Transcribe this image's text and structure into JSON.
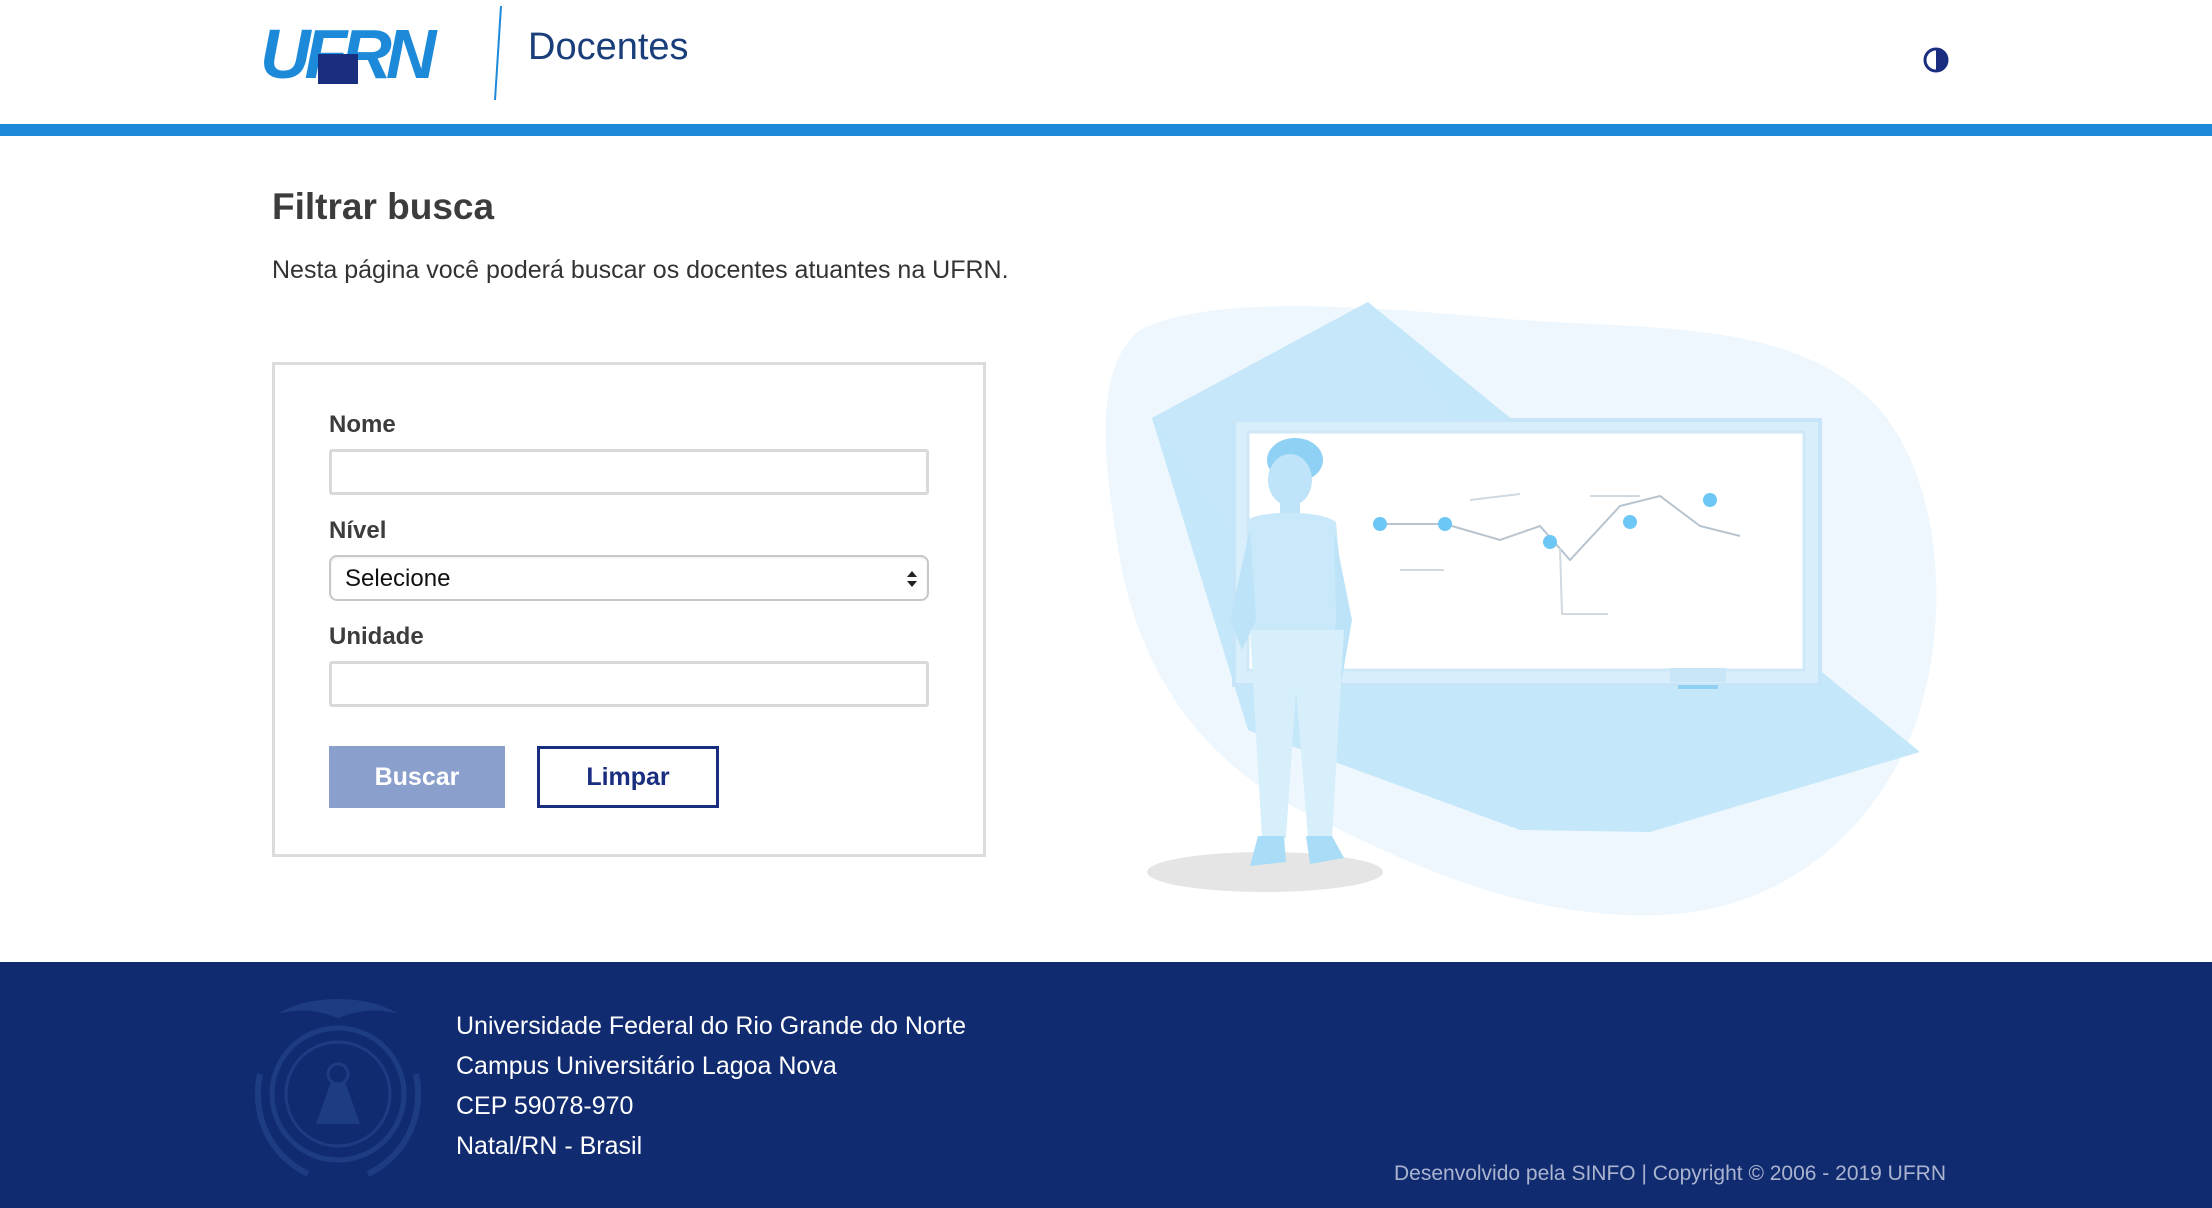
{
  "header": {
    "logo_text": "UFRN",
    "app_title": "Docentes",
    "contrast_icon": "contrast-icon",
    "accent_color": "#1c8ad9"
  },
  "main": {
    "title": "Filtrar busca",
    "description": "Nesta página você poderá buscar os docentes atuantes na UFRN."
  },
  "form": {
    "nome": {
      "label": "Nome",
      "value": "",
      "placeholder": ""
    },
    "nivel": {
      "label": "Nível",
      "selected": "Selecione"
    },
    "unidade": {
      "label": "Unidade",
      "value": "",
      "placeholder": ""
    },
    "buscar_label": "Buscar",
    "limpar_label": "Limpar"
  },
  "footer": {
    "lines": [
      "Universidade Federal do Rio Grande do Norte",
      "Campus Universitário Lagoa Nova",
      "CEP 59078-970",
      "Natal/RN - Brasil"
    ],
    "copyright": "Desenvolvido pela SINFO | Copyright © 2006 - 2019 UFRN",
    "background_color": "#112b70"
  }
}
